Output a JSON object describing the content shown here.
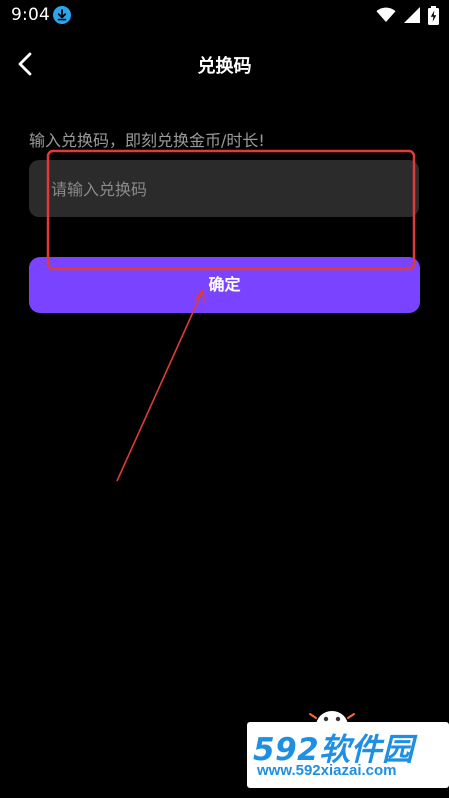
{
  "status_bar": {
    "time": "9:04",
    "icons": [
      "download-icon",
      "wifi-icon",
      "signal-icon",
      "battery-charging-icon"
    ]
  },
  "header": {
    "title": "兑换码",
    "back_icon": "chevron-left-icon"
  },
  "main": {
    "instruction": "输入兑换码，即刻兑换金币/时长!",
    "code_input": {
      "placeholder": "请输入兑换码",
      "value": ""
    },
    "confirm_label": "确定"
  },
  "colors": {
    "background": "#000000",
    "input_background": "#2b2b2b",
    "accent": "#7a43ff",
    "annotation": "#e03a3a",
    "watermark": "#1f8fe3"
  },
  "watermark": {
    "brand": "592软件园",
    "url": "www.592xiazai.com"
  }
}
